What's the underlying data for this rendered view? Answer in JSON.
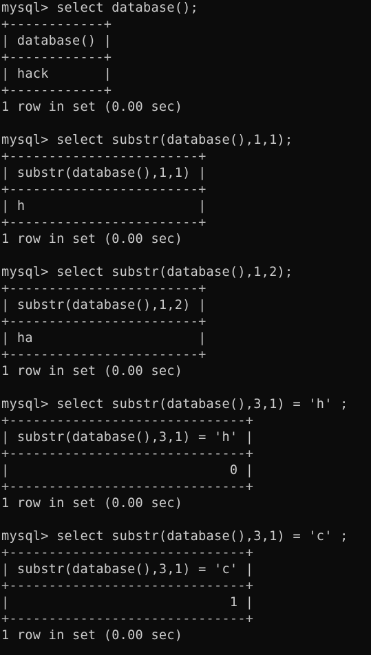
{
  "terminal": {
    "lines": [
      "mysql> select database();",
      "+------------+",
      "| database() |",
      "+------------+",
      "| hack       |",
      "+------------+",
      "1 row in set (0.00 sec)",
      "",
      "mysql> select substr(database(),1,1);",
      "+------------------------+",
      "| substr(database(),1,1) |",
      "+------------------------+",
      "| h                      |",
      "+------------------------+",
      "1 row in set (0.00 sec)",
      "",
      "mysql> select substr(database(),1,2);",
      "+------------------------+",
      "| substr(database(),1,2) |",
      "+------------------------+",
      "| ha                     |",
      "+------------------------+",
      "1 row in set (0.00 sec)",
      "",
      "mysql> select substr(database(),3,1) = 'h' ;",
      "+------------------------------+",
      "| substr(database(),3,1) = 'h' |",
      "+------------------------------+",
      "|                            0 |",
      "+------------------------------+",
      "1 row in set (0.00 sec)",
      "",
      "mysql> select substr(database(),3,1) = 'c' ;",
      "+------------------------------+",
      "| substr(database(),3,1) = 'c' |",
      "+------------------------------+",
      "|                            1 |",
      "+------------------------------+",
      "1 row in set (0.00 sec)"
    ]
  }
}
